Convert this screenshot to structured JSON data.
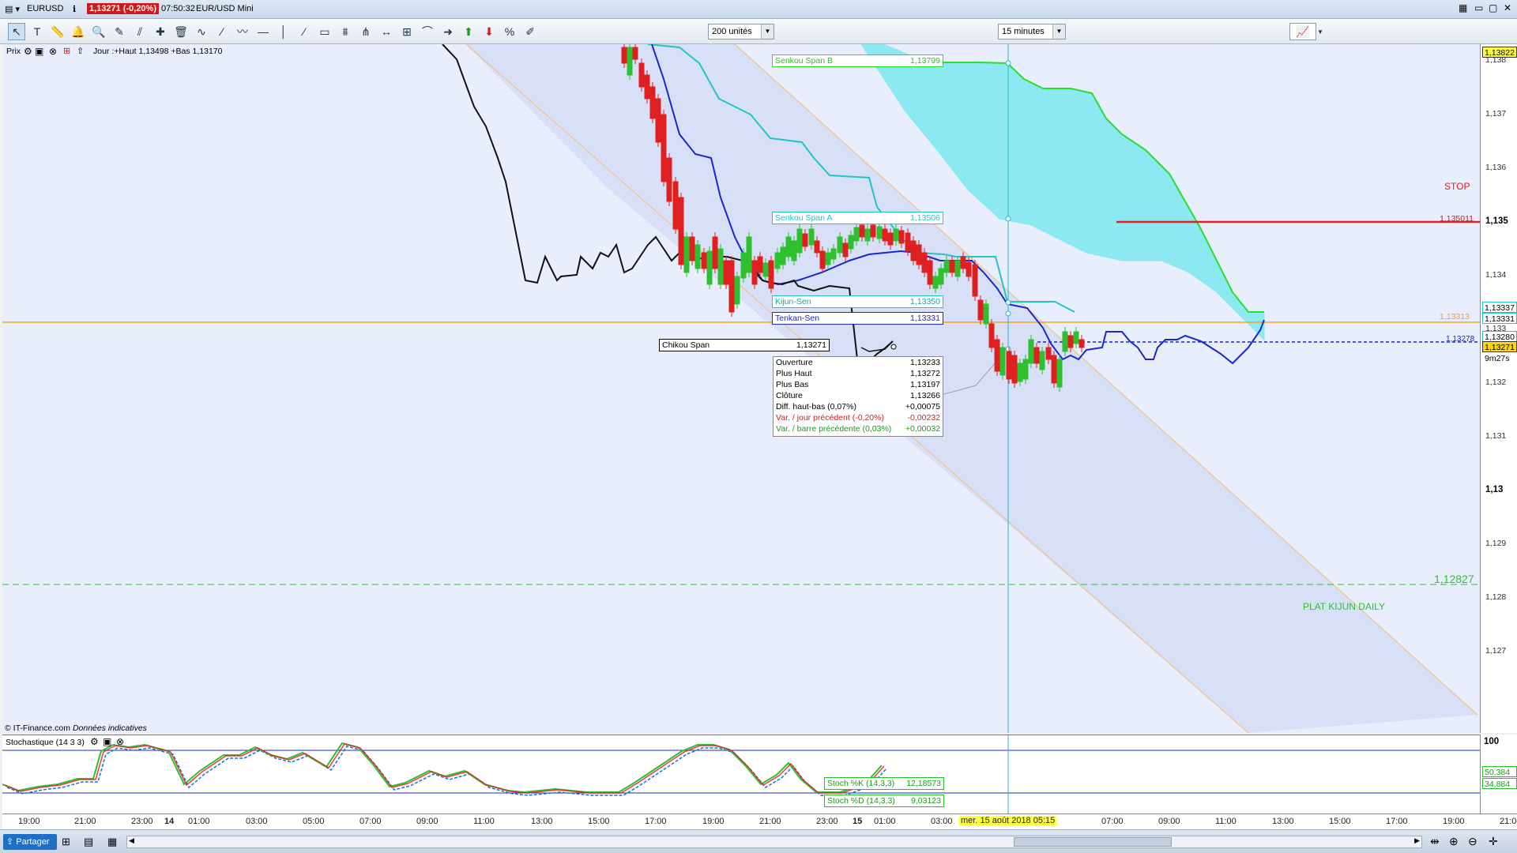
{
  "titlebar": {
    "symbol": "EURUSD",
    "price_badge": "1,13271 (-0,20%)",
    "time": "07:50:32",
    "instrument": "EUR/USD Mini"
  },
  "toolbar": {
    "units_select": "200 unités",
    "timeframe_select": "15 minutes"
  },
  "chart": {
    "price_header_label": "Prix",
    "price_header_info": "Jour :+Haut 1,13498 +Bas 1,13170",
    "source_note": "© IT-Finance.com",
    "source_note_italic": "Données indicatives",
    "stop_label": "STOP",
    "stop_value": "1,135011",
    "plat_kijun_label": "PLAT KIJUN DAILY",
    "plat_kijun_value": "1,12827",
    "orange_line_value": "1,13313",
    "blue_dash_value": "1,13278",
    "colors": {
      "background": "#e8eefc",
      "cloud": "#6ee6ee",
      "senkou_b": "#28e028",
      "kijun": "#22c4c4",
      "tenkan": "#1a28c8",
      "chikou": "#111111",
      "candle_up": "#2fc02f",
      "candle_down": "#e02020",
      "stop_line": "#dd2020",
      "orange_line": "#f2a233",
      "plat_line": "#30c030"
    }
  },
  "indicators": {
    "senkou_b": {
      "label": "Senkou Span B",
      "value": "1,13799"
    },
    "senkou_a": {
      "label": "Senkou Span A",
      "value": "1,13506"
    },
    "kijun": {
      "label": "Kijun-Sen",
      "value": "1,13350"
    },
    "tenkan": {
      "label": "Tenkan-Sen",
      "value": "1,13331"
    },
    "chikou": {
      "label": "Chikou Span",
      "value": "1,13271"
    }
  },
  "infobox": {
    "rows": [
      {
        "label": "Ouverture",
        "value": "1,13233",
        "color": "#000"
      },
      {
        "label": "Plus Haut",
        "value": "1,13272",
        "color": "#000"
      },
      {
        "label": "Plus Bas",
        "value": "1,13197",
        "color": "#000"
      },
      {
        "label": "Clôture",
        "value": "1,13266",
        "color": "#000"
      },
      {
        "label": "Diff. haut-bas (0,07%)",
        "value": "+0,00075",
        "color": "#000"
      },
      {
        "label": "Var. / jour précédent (-0,20%)",
        "value": "-0,00232",
        "color": "#d02020"
      },
      {
        "label": "Var. / barre précédente (0,03%)",
        "value": "+0,00032",
        "color": "#1a9a1a"
      }
    ]
  },
  "y_axis": {
    "ticks": [
      "1,138",
      "1,137",
      "1,136",
      "1,135",
      "1,134",
      "1,133",
      "1,132",
      "1,131",
      "1,13",
      "1,129",
      "1,128",
      "1,127"
    ],
    "tags": [
      {
        "text": "1,13822",
        "bg": "#ffff40",
        "border": "#333"
      },
      {
        "text": "1,13337",
        "bg": "#fff",
        "border": "#22c4c4"
      },
      {
        "text": "1,13331",
        "bg": "#fff",
        "border": "#22c4c4"
      },
      {
        "text": "1,13280",
        "bg": "#fff",
        "border": "#22c4c4"
      },
      {
        "text": "1,13271",
        "bg": "#ffd700",
        "border": "#333"
      },
      {
        "text": "9m27s",
        "bg": "#fff",
        "border": "#fff"
      }
    ]
  },
  "stochastic": {
    "title": "Stochastique (14 3 3)",
    "k_label": "Stoch %K (14,3,3)",
    "k_value": "12,18573",
    "d_label": "Stoch %D (14,3,3)",
    "d_value": "9,03123",
    "axis_top": "100",
    "axis_tags": [
      "50,384",
      "34,884"
    ]
  },
  "x_axis": {
    "ticks": [
      "19:00",
      "21:00",
      "23:00",
      "14",
      "01:00",
      "03:00",
      "05:00",
      "07:00",
      "09:00",
      "11:00",
      "13:00",
      "15:00",
      "17:00",
      "19:00",
      "21:00",
      "23:00",
      "15",
      "01:00",
      "03:00",
      "07:00",
      "09:00",
      "11:00",
      "13:00",
      "15:00",
      "17:00",
      "19:00",
      "21:00"
    ],
    "cursor_date": "mer. 15 août 2018 05:15"
  },
  "bottombar": {
    "share_label": "Partager"
  }
}
